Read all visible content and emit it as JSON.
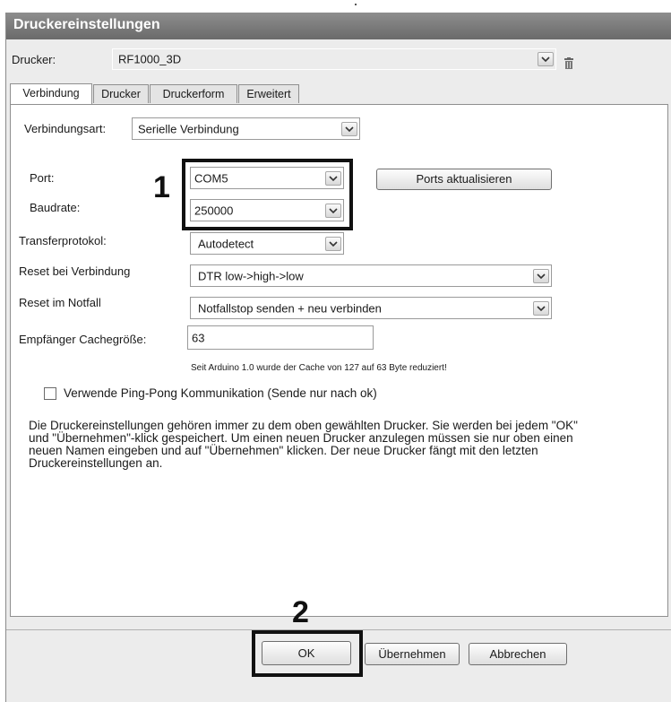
{
  "window": {
    "title": "Druckereinstellungen"
  },
  "printer": {
    "label": "Drucker:",
    "value": "RF1000_3D",
    "delete_icon": "trash-icon"
  },
  "tabs": [
    {
      "label": "Verbindung",
      "active": true
    },
    {
      "label": "Drucker",
      "active": false
    },
    {
      "label": "Druckerform",
      "active": false
    },
    {
      "label": "Erweitert",
      "active": false
    }
  ],
  "connection": {
    "type_label": "Verbindungsart:",
    "type_value": "Serielle Verbindung",
    "port_label": "Port:",
    "port_value": "COM5",
    "refresh_ports_label": "Ports aktualisieren",
    "baudrate_label": "Baudrate:",
    "baudrate_value": "250000",
    "protocol_label": "Transferprotokol:",
    "protocol_value": "Autodetect",
    "reset_connect_label": "Reset bei Verbindung",
    "reset_connect_value": "DTR low->high->low",
    "reset_emergency_label": "Reset im Notfall",
    "reset_emergency_value": "Notfallstop senden + neu verbinden",
    "cache_label": "Empfänger Cachegröße:",
    "cache_value": "63",
    "cache_note": "Seit Arduino 1.0 wurde der Cache von 127 auf 63 Byte reduziert!",
    "pingpong_label": "Verwende Ping-Pong Kommunikation (Sende nur nach ok)",
    "pingpong_checked": false,
    "info_lines": [
      "Die Druckereinstellungen gehören immer zu dem oben gewählten Drucker. Sie werden bei jedem \"OK\"",
      "und \"Übernehmen\"-klick gespeichert. Um einen neuen Drucker anzulegen müssen sie nur oben einen",
      "neuen Namen eingeben und auf \"Übernehmen\" klicken. Der neue Drucker fängt mit den letzten",
      "Druckereinstellungen an."
    ]
  },
  "annotations": {
    "marker1": "1",
    "marker2": "2"
  },
  "buttons": {
    "ok": "OK",
    "apply": "Übernehmen",
    "cancel": "Abbrechen"
  }
}
